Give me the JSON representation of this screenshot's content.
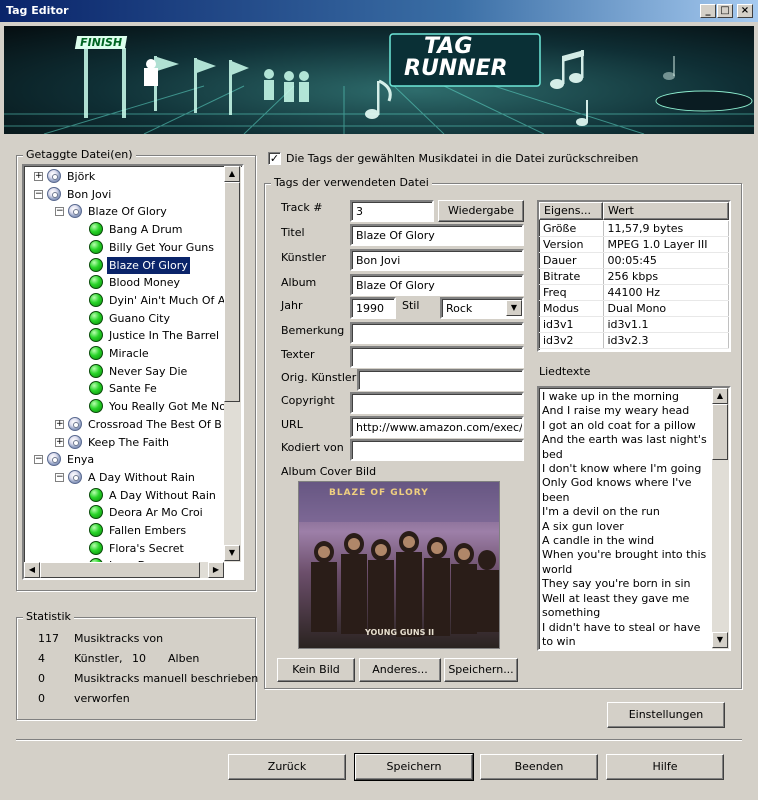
{
  "window": {
    "title": "Tag Editor",
    "controls": {
      "minimize": "_",
      "maximize": "□",
      "close": "×"
    }
  },
  "banner": {
    "finish_label": "FINISH",
    "logo_line1": "TAG",
    "logo_line2": "RUNNER"
  },
  "tagged_files": {
    "legend": "Getaggte Datei(en)",
    "items": [
      {
        "label": "Björk",
        "level": 0,
        "type": "cd",
        "expander": "+"
      },
      {
        "label": "Bon Jovi",
        "level": 0,
        "type": "cd",
        "expander": "-"
      },
      {
        "label": "Blaze Of Glory",
        "level": 1,
        "type": "cd",
        "expander": "-"
      },
      {
        "label": "Bang A Drum",
        "level": 2,
        "type": "track"
      },
      {
        "label": "Billy Get Your Guns",
        "level": 2,
        "type": "track"
      },
      {
        "label": "Blaze Of Glory",
        "level": 2,
        "type": "track",
        "selected": true
      },
      {
        "label": "Blood Money",
        "level": 2,
        "type": "track"
      },
      {
        "label": "Dyin' Ain't Much Of A",
        "level": 2,
        "type": "track"
      },
      {
        "label": "Guano City",
        "level": 2,
        "type": "track"
      },
      {
        "label": "Justice In The Barrel",
        "level": 2,
        "type": "track"
      },
      {
        "label": "Miracle",
        "level": 2,
        "type": "track"
      },
      {
        "label": "Never Say Die",
        "level": 2,
        "type": "track"
      },
      {
        "label": "Sante Fe",
        "level": 2,
        "type": "track"
      },
      {
        "label": "You Really Got Me No",
        "level": 2,
        "type": "track"
      },
      {
        "label": "Crossroad The Best Of B",
        "level": 1,
        "type": "cd",
        "expander": "+"
      },
      {
        "label": "Keep The Faith",
        "level": 1,
        "type": "cd",
        "expander": "+"
      },
      {
        "label": "Enya",
        "level": 0,
        "type": "cd",
        "expander": "-"
      },
      {
        "label": "A   Day Without Rain",
        "level": 1,
        "type": "cd",
        "expander": "-"
      },
      {
        "label": "A Day Without Rain",
        "level": 2,
        "type": "track"
      },
      {
        "label": "Deora Ar Mo Croi",
        "level": 2,
        "type": "track"
      },
      {
        "label": "Fallen Embers",
        "level": 2,
        "type": "track"
      },
      {
        "label": "Flora's Secret",
        "level": 2,
        "type": "track"
      },
      {
        "label": "Lazy Days",
        "level": 2,
        "type": "track"
      }
    ]
  },
  "statistics": {
    "legend": "Statistik",
    "rows": [
      {
        "count": "117",
        "text": "Musiktracks von"
      },
      {
        "count": "4",
        "text": "Künstler,",
        "extra_count": "10",
        "extra_text": "Alben"
      },
      {
        "count": "0",
        "text": "Musiktracks manuell beschrieben"
      },
      {
        "count": "0",
        "text": "verworfen"
      }
    ]
  },
  "writeback": {
    "checked": true,
    "label": "Die Tags der gewählten Musikdatei in die Datei zurückschreiben"
  },
  "tags": {
    "legend": "Tags der verwendeten Datei",
    "track_label": "Track #",
    "track_value": "3",
    "play_button": "Wiedergabe",
    "title_label": "Titel",
    "title_value": "Blaze Of Glory",
    "artist_label": "Künstler",
    "artist_value": "Bon Jovi",
    "album_label": "Album",
    "album_value": "Blaze Of Glory",
    "year_label": "Jahr",
    "year_value": "1990",
    "genre_label": "Stil",
    "genre_value": "Rock",
    "comment_label": "Bemerkung",
    "comment_value": "",
    "lyricist_label": "Texter",
    "lyricist_value": "",
    "orig_artist_label": "Orig. Künstler",
    "orig_artist_value": "",
    "copyright_label": "Copyright",
    "copyright_value": "",
    "url_label": "URL",
    "url_value": "http://www.amazon.com/exec/",
    "encoded_label": "Kodiert von",
    "encoded_value": "",
    "cover_label": "Album Cover Bild",
    "cover_band_text": "BLAZE OF GLORY",
    "cover_sub_text": "YOUNG GUNS II",
    "no_image_button": "Kein Bild",
    "other_button": "Anderes...",
    "save_image_button": "Speichern..."
  },
  "properties": {
    "col_property": "Eigens...",
    "col_value": "Wert",
    "rows": [
      {
        "k": "Größe",
        "v": "11,57,9 bytes"
      },
      {
        "k": "Version",
        "v": "MPEG 1.0 Layer III"
      },
      {
        "k": "Dauer",
        "v": "00:05:45"
      },
      {
        "k": "Bitrate",
        "v": "256 kbps"
      },
      {
        "k": "Freq",
        "v": "44100 Hz"
      },
      {
        "k": "Modus",
        "v": "Dual Mono"
      },
      {
        "k": "id3v1",
        "v": "id3v1.1"
      },
      {
        "k": "id3v2",
        "v": "id3v2.3"
      }
    ]
  },
  "lyrics": {
    "label": "Liedtexte",
    "lines": [
      "I wake up in the morning",
      "And I raise my weary head",
      "I got an old coat for a pillow",
      "And the earth was last night's",
      "bed",
      "I don't know where I'm going",
      "Only God knows where I've",
      "been",
      "I'm a devil on the run",
      "A six gun lover",
      "A candle in the wind",
      "When you're brought into this",
      "world",
      "They say you're born in sin",
      "Well at least they gave me",
      "something",
      "I didn't have to steal or have",
      "to win"
    ]
  },
  "buttons": {
    "settings": "Einstellungen",
    "back": "Zurück",
    "save": "Speichern",
    "quit": "Beenden",
    "help": "Hilfe"
  }
}
